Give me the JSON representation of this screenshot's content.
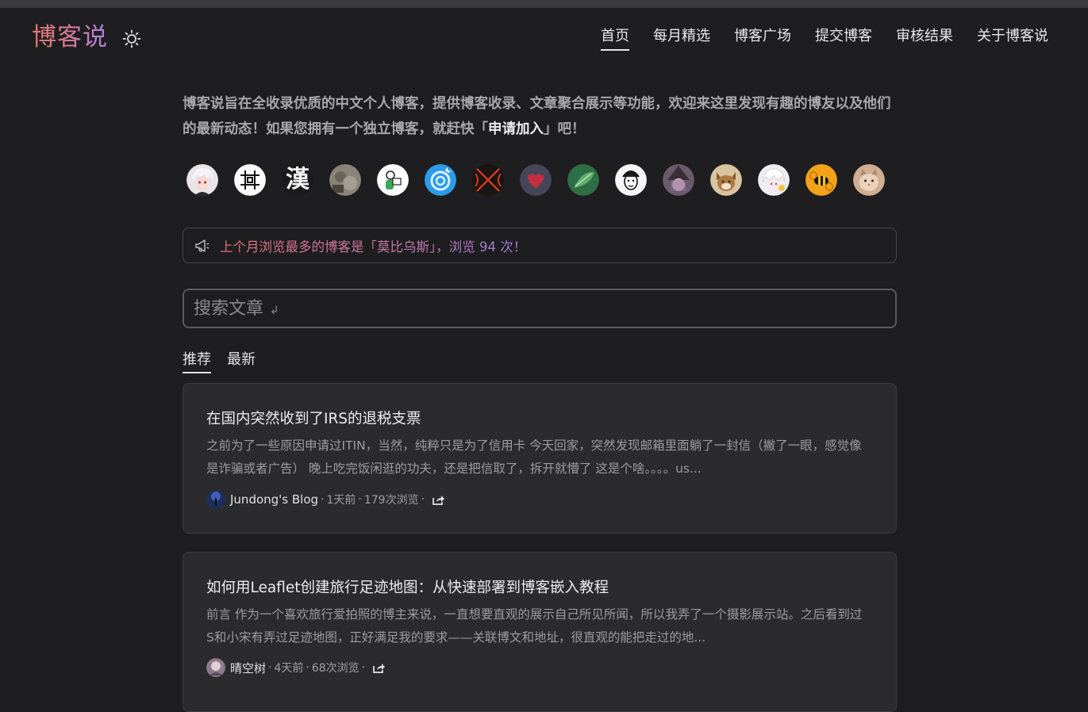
{
  "site": {
    "logo": "博客说"
  },
  "nav": {
    "items": [
      {
        "label": "首页",
        "active": true
      },
      {
        "label": "每月精选"
      },
      {
        "label": "博客广场"
      },
      {
        "label": "提交博客"
      },
      {
        "label": "审核结果"
      },
      {
        "label": "关于博客说"
      }
    ]
  },
  "intro": {
    "text_before": "博客说旨在全收录优质的中文个人博客，提供博客收录、文章聚合展示等功能，欢迎来这里发现有趣的博友以及他们的最新动态！如果您拥有一个独立博客，就赶快「",
    "join_link": "申请加入",
    "text_after": "」吧！"
  },
  "avatars": [
    {
      "icon": "avatar-white-hair-anime"
    },
    {
      "icon": "avatar-black-white-glyph"
    },
    {
      "icon": "avatar-han-character",
      "glyph": "漢"
    },
    {
      "icon": "avatar-sepia-photo"
    },
    {
      "icon": "avatar-cartoon-reader"
    },
    {
      "icon": "avatar-blue-swirl"
    },
    {
      "icon": "avatar-red-x"
    },
    {
      "icon": "avatar-pixel-heart"
    },
    {
      "icon": "avatar-green-leaf"
    },
    {
      "icon": "avatar-line-portrait"
    },
    {
      "icon": "avatar-witch-anime"
    },
    {
      "icon": "avatar-fox-character"
    },
    {
      "icon": "avatar-white-anime-girl"
    },
    {
      "icon": "avatar-bee-honeycomb"
    },
    {
      "icon": "avatar-cat-photo"
    }
  ],
  "notice": {
    "icon": "megaphone-icon",
    "text": "上个月浏览最多的博客是「莫比乌斯」，浏览 94 次！"
  },
  "search": {
    "placeholder": "搜索文章",
    "enter_hint": "↲"
  },
  "tabs": [
    {
      "label": "推荐",
      "active": true
    },
    {
      "label": "最新"
    }
  ],
  "articles": [
    {
      "title": "在国内突然收到了IRS的退税支票",
      "excerpt": "之前为了一些原因申请过ITIN，当然，纯粹只是为了信用卡 今天回家，突然发现邮箱里面躺了一封信（撇了一眼，感觉像是诈骗或者广告） 晚上吃完饭闲逛的功夫，还是把信取了，拆开就懵了 这是个啥。。。。us...",
      "blog": "Jundong's Blog",
      "time": "1天前",
      "views": "179次浏览",
      "separator": "·",
      "icon": "share-icon"
    },
    {
      "title": "如何用Leaflet创建旅行足迹地图：从快速部署到博客嵌入教程",
      "excerpt": "前言 作为一个喜欢旅行爱拍照的博主来说，一直想要直观的展示自己所见所闻，所以我弄了一个摄影展示站。之后看到过S和小宋有弄过足迹地图，正好满足我的要求——关联博文和地址，很直观的能把走过的地...",
      "blog": "晴空树",
      "time": "4天前",
      "views": "68次浏览",
      "separator": "·",
      "icon": "share-icon"
    }
  ],
  "colors": {
    "background": "#1e1e20",
    "card": "#2b2b2e",
    "border": "#3c3c40",
    "logo_gradient_start": "#e4786a",
    "logo_gradient_end": "#a882e6"
  }
}
